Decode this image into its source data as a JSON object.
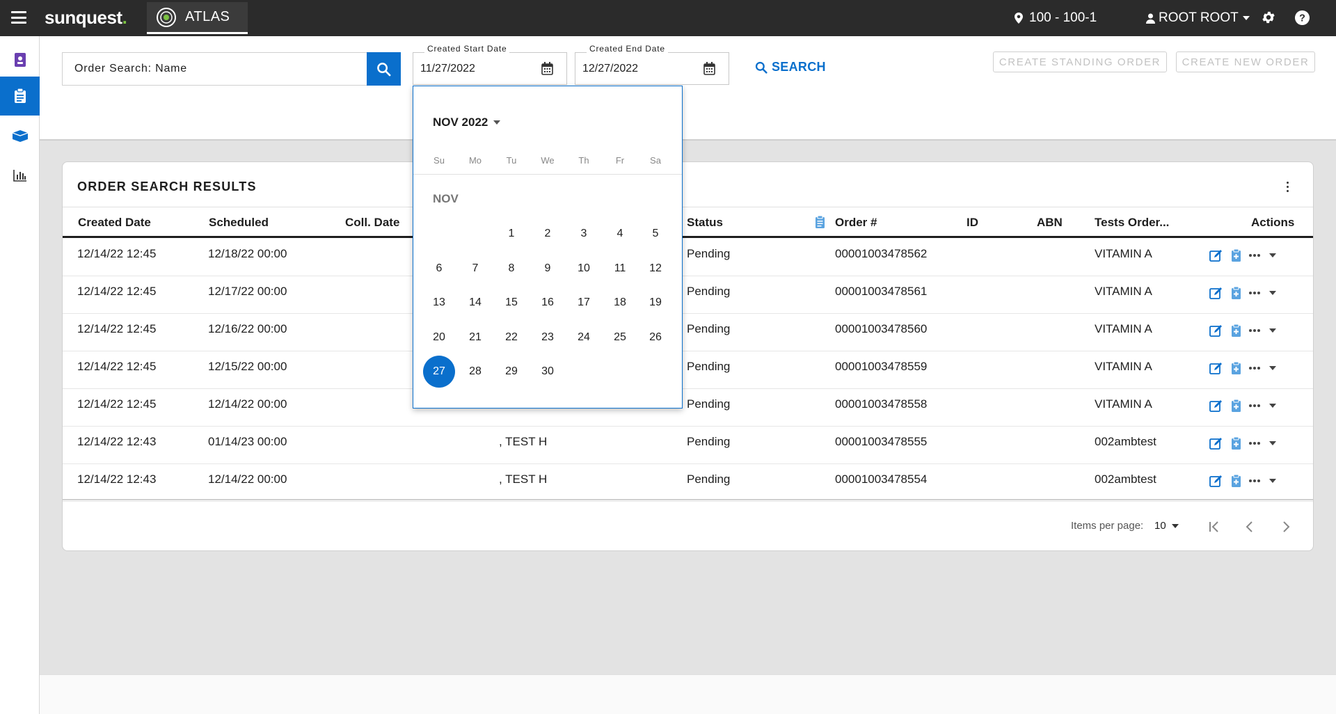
{
  "topbar": {
    "brand": "sunquest",
    "brand_dot": ".",
    "app_tab": "ATLAS",
    "location": "100 - 100-1",
    "user": "ROOT ROOT"
  },
  "search": {
    "value": "Order Search: Name",
    "start_date_label": "Created Start Date",
    "start_date_value": "11/27/2022",
    "end_date_label": "Created End Date",
    "end_date_value": "12/27/2022",
    "search_label": "SEARCH"
  },
  "buttons": {
    "standing_order": "CREATE STANDING ORDER",
    "new_order": "CREATE NEW ORDER"
  },
  "results": {
    "title": "ORDER SEARCH RESULTS",
    "columns": [
      "Created Date",
      "Scheduled",
      "Coll. Date",
      "Status",
      "Order #",
      "ID",
      "ABN",
      "Tests Order...",
      "Actions"
    ],
    "rows": [
      {
        "created": "12/14/22 12:45",
        "scheduled": "12/18/22 00:00",
        "name": "",
        "status": "Pending",
        "order": "00001003478562",
        "tests": "VITAMIN A"
      },
      {
        "created": "12/14/22 12:45",
        "scheduled": "12/17/22 00:00",
        "name": "",
        "status": "Pending",
        "order": "00001003478561",
        "tests": "VITAMIN A"
      },
      {
        "created": "12/14/22 12:45",
        "scheduled": "12/16/22 00:00",
        "name": "",
        "status": "Pending",
        "order": "00001003478560",
        "tests": "VITAMIN A"
      },
      {
        "created": "12/14/22 12:45",
        "scheduled": "12/15/22 00:00",
        "name": "",
        "status": "Pending",
        "order": "00001003478559",
        "tests": "VITAMIN A"
      },
      {
        "created": "12/14/22 12:45",
        "scheduled": "12/14/22 00:00",
        "name": "",
        "status": "Pending",
        "order": "00001003478558",
        "tests": "VITAMIN A"
      },
      {
        "created": "12/14/22 12:43",
        "scheduled": "01/14/23 00:00",
        "name": ", TEST H",
        "status": "Pending",
        "order": "00001003478555",
        "tests": "002ambtest"
      },
      {
        "created": "12/14/22 12:43",
        "scheduled": "12/14/22 00:00",
        "name": ", TEST H",
        "status": "Pending",
        "order": "00001003478554",
        "tests": "002ambtest"
      }
    ],
    "items_per_page_label": "Items per page:",
    "items_per_page_value": "10"
  },
  "calendar": {
    "month_year": "NOV 2022",
    "month_label": "NOV",
    "weekdays": [
      "Su",
      "Mo",
      "Tu",
      "We",
      "Th",
      "Fr",
      "Sa"
    ],
    "first_weekday_index": 2,
    "days_in_month": 30,
    "selected_day": 27
  },
  "icons": {
    "menu": "hamburger-icon",
    "location": "map-pin-icon",
    "user": "user-icon",
    "settings": "gear-icon",
    "help": "help-circle-icon",
    "search": "search-icon",
    "calendar": "calendar-icon"
  },
  "colors": {
    "accent": "#0a6fcc",
    "topbar": "#2b2b2b",
    "brand_dot": "#7cc242",
    "background": "#e3e3e3"
  }
}
